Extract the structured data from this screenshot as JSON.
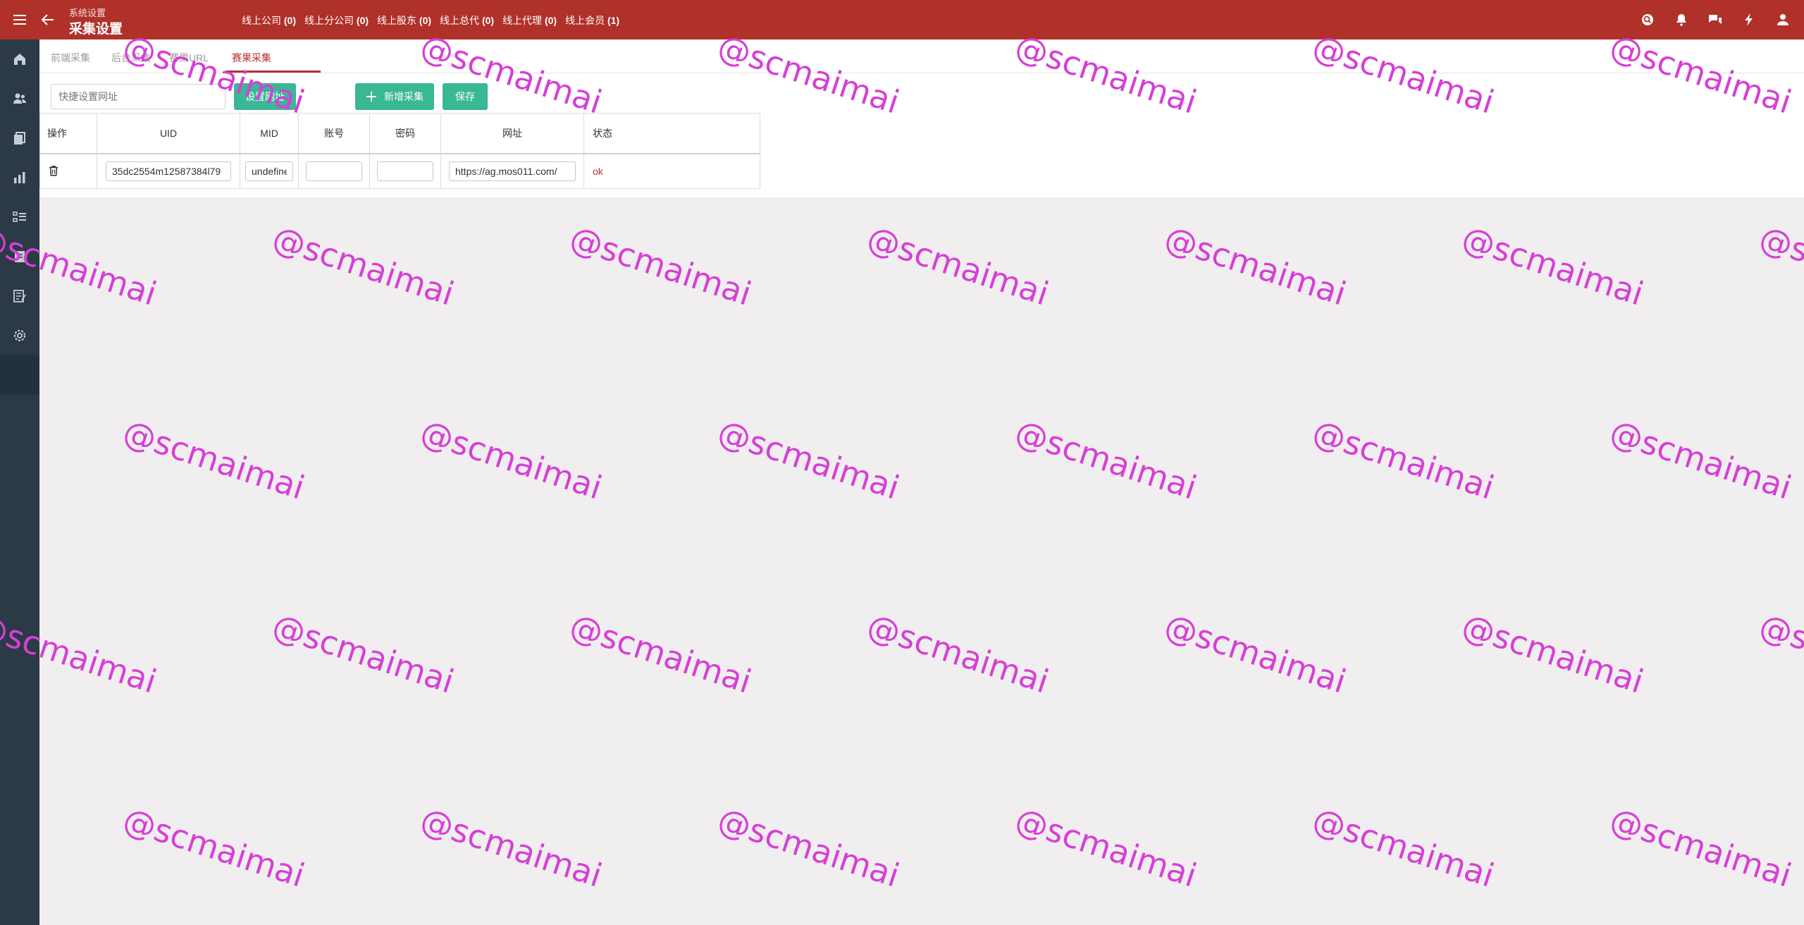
{
  "header": {
    "breadcrumb": "系统设置",
    "title": "采集设置",
    "stats": [
      {
        "label": "线上公司",
        "count": "(0)"
      },
      {
        "label": "线上分公司",
        "count": "(0)"
      },
      {
        "label": "线上股东",
        "count": "(0)"
      },
      {
        "label": "线上总代",
        "count": "(0)"
      },
      {
        "label": "线上代理",
        "count": "(0)"
      },
      {
        "label": "线上会员",
        "count": "(1)"
      }
    ],
    "icons": [
      "search-icon",
      "bell-icon",
      "chat-icon",
      "lightning-icon",
      "user-icon"
    ]
  },
  "sidebar": {
    "items": [
      "home-icon",
      "users-icon",
      "documents-icon",
      "chart-icon",
      "list-icon",
      "report-icon",
      "notes-icon",
      "settings-icon"
    ],
    "active": "settings-icon"
  },
  "tabs": [
    {
      "label": "前端采集"
    },
    {
      "label": "后台采集"
    },
    {
      "label": "赛果URL"
    },
    {
      "label": "赛果采集"
    }
  ],
  "active_tab": "赛果采集",
  "toolbar": {
    "quick_placeholder": "快捷设置网址",
    "set_url_label": "设置网址",
    "add_label": "新增采集",
    "save_label": "保存"
  },
  "table": {
    "columns": [
      "操作",
      "UID",
      "MID",
      "账号",
      "密码",
      "网址",
      "状态"
    ],
    "rows": [
      {
        "uid": "35dc2554m12587384l79",
        "mid": "undefined",
        "account": "",
        "password": "",
        "url": "https://ag.mos011.com/",
        "status": "ok"
      }
    ]
  },
  "watermark": "@scmaimai",
  "colors": {
    "header": "#b0302a",
    "sidebar": "#2c3947",
    "button": "#3ab795",
    "watermark": "#d63fd6"
  }
}
